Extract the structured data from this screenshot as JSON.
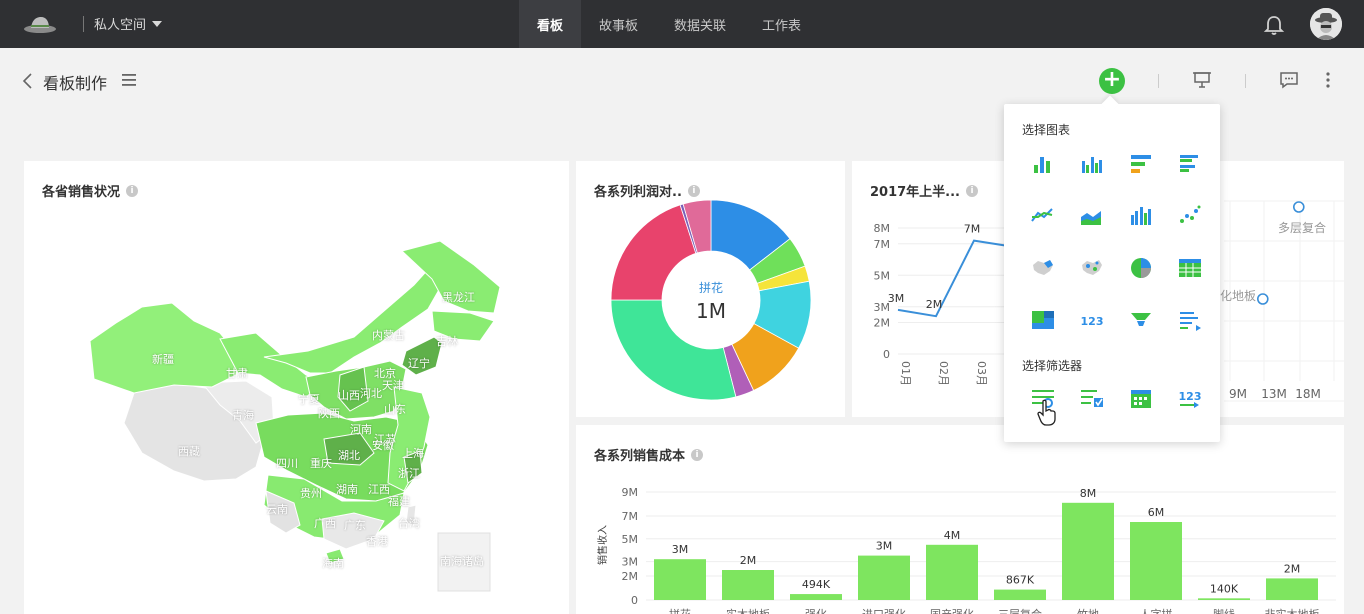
{
  "topbar": {
    "space_label": "私人空间",
    "tabs": [
      {
        "label": "看板",
        "active": true
      },
      {
        "label": "故事板",
        "active": false
      },
      {
        "label": "数据关联",
        "active": false
      },
      {
        "label": "工作表",
        "active": false
      }
    ]
  },
  "subheader": {
    "title": "看板制作"
  },
  "colors": {
    "topbar_bg": "#2f3033",
    "accent_green": "#3cc143",
    "bar_green": "#7ee55f",
    "line_blue": "#3a8fd9",
    "icon_blue": "#2d8ee6"
  },
  "cards": {
    "map_title": "各省销售状况",
    "donut_title": "各系列利润对..",
    "line_title": "2017年上半...",
    "bar_title": "各系列销售成本",
    "scatter_label_a": "多层复合",
    "scatter_label_b": "化地板"
  },
  "map": {
    "province_labels": [
      "黑龙江",
      "吉林",
      "内蒙古",
      "辽宁",
      "北京",
      "天津",
      "新疆",
      "甘肃",
      "宁夏",
      "山西",
      "河北",
      "陕西",
      "山东",
      "青海",
      "河南",
      "江苏",
      "上海",
      "西藏",
      "四川",
      "重庆",
      "湖北",
      "安徽",
      "浙江",
      "贵州",
      "湖南",
      "江西",
      "福建",
      "云南",
      "广西",
      "广东",
      "台湾",
      "香港",
      "海南",
      "南海诸岛"
    ]
  },
  "popover": {
    "chart_section_label": "选择图表",
    "filter_section_label": "选择筛选器",
    "chart_icons": [
      "bar-chart-icon",
      "grouped-bar-icon",
      "horizontal-bar-icon",
      "grouped-horizontal-bar-icon",
      "line-chart-icon",
      "area-chart-icon",
      "multi-bar-icon",
      "scatter-icon",
      "map-icon",
      "dot-map-icon",
      "pie-chart-icon",
      "table-icon",
      "treemap-icon",
      "number-icon",
      "funnel-icon",
      "progress-bar-icon"
    ],
    "filter_icons": [
      "list-filter-icon",
      "checkbox-filter-icon",
      "date-filter-icon",
      "number-filter-icon"
    ],
    "number_glyph": "123"
  },
  "chart_data": [
    {
      "type": "pie",
      "donut": true,
      "title": "各系列利润对..",
      "center_label": "拼花",
      "center_value": "1M",
      "slices": [
        {
          "value": 14.5,
          "color": "#2d8ee6"
        },
        {
          "value": 5,
          "color": "#6fe05a"
        },
        {
          "value": 2.5,
          "color": "#f5e43a"
        },
        {
          "value": 11,
          "color": "#3fd3e0"
        },
        {
          "value": 10,
          "color": "#f0a21c"
        },
        {
          "value": 3,
          "color": "#b05fb8"
        },
        {
          "value": 29,
          "color": "#3fe598"
        },
        {
          "value": 20,
          "color": "#e8436c"
        },
        {
          "value": 0.5,
          "color": "#7a5fb8"
        },
        {
          "value": 4.5,
          "color": "#e06a99"
        }
      ]
    },
    {
      "type": "line",
      "title": "2017年上半...",
      "categories": [
        "01月",
        "02月",
        "03月"
      ],
      "values": [
        2.8,
        2.4,
        7.2
      ],
      "point_labels": [
        "3M",
        "2M",
        "7M"
      ],
      "y_ticks": [
        "0",
        "2M",
        "3M",
        "5M",
        "7M",
        "8M"
      ],
      "y_tick_values": [
        0,
        2,
        3,
        5,
        7,
        8
      ],
      "ylim": [
        0,
        8
      ]
    },
    {
      "type": "bar",
      "title": "各系列销售成本",
      "ylabel": "销售收入",
      "categories": [
        "拼花",
        "实木地板",
        "强化",
        "进口强化",
        "国产强化",
        "三层复合",
        "竹地",
        "人字拼",
        "脚线",
        "非实木地板"
      ],
      "values": [
        3.4,
        2.5,
        0.494,
        3.7,
        4.6,
        0.867,
        8.1,
        6.5,
        0.14,
        1.8
      ],
      "value_labels": [
        "3M",
        "2M",
        "494K",
        "3M",
        "4M",
        "867K",
        "8M",
        "6M",
        "140K",
        "2M"
      ],
      "y_ticks": [
        "0",
        "2M",
        "3M",
        "5M",
        "7M",
        "9M"
      ],
      "y_tick_values": [
        0,
        2,
        3.2,
        5.1,
        7,
        9
      ],
      "ylim": [
        0,
        9
      ]
    },
    {
      "type": "scatter",
      "x_tick_labels": [
        "9M",
        "13M",
        "18M"
      ],
      "points": [
        {
          "label": "多层复合",
          "x": 18,
          "y": 8
        },
        {
          "label": "化地板",
          "x": 13,
          "y": 4
        }
      ]
    }
  ]
}
